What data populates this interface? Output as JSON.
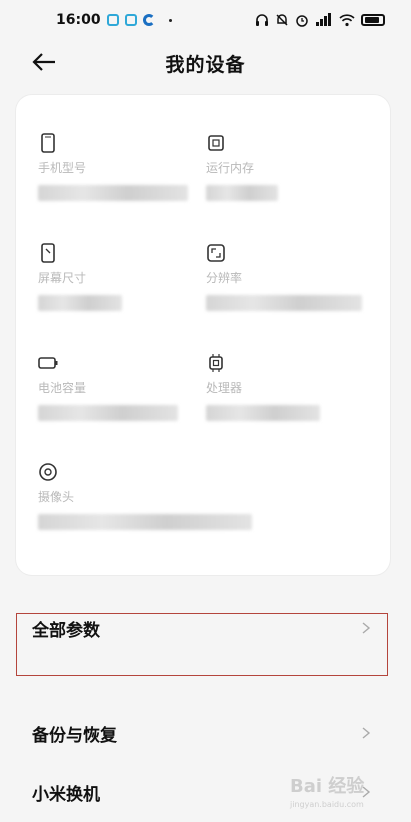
{
  "status_bar": {
    "time": "16:00"
  },
  "header": {
    "title": "我的设备"
  },
  "specs": [
    {
      "label": "手机型号",
      "icon": "phone-icon"
    },
    {
      "label": "运行内存",
      "icon": "memory-chip-icon"
    },
    {
      "label": "屏幕尺寸",
      "icon": "screen-size-icon"
    },
    {
      "label": "分辨率",
      "icon": "resolution-icon"
    },
    {
      "label": "电池容量",
      "icon": "battery-icon"
    },
    {
      "label": "处理器",
      "icon": "processor-icon"
    },
    {
      "label": "摄像头",
      "icon": "camera-icon"
    }
  ],
  "rows": [
    {
      "label": "全部参数"
    },
    {
      "label": "备份与恢复"
    },
    {
      "label": "小米换机"
    }
  ],
  "watermark": {
    "text": "Bai 经验",
    "sub": "jingyan.baidu.com"
  },
  "colors": {
    "highlight_border": "#b4453c",
    "label_gray": "#b9b9b9"
  }
}
